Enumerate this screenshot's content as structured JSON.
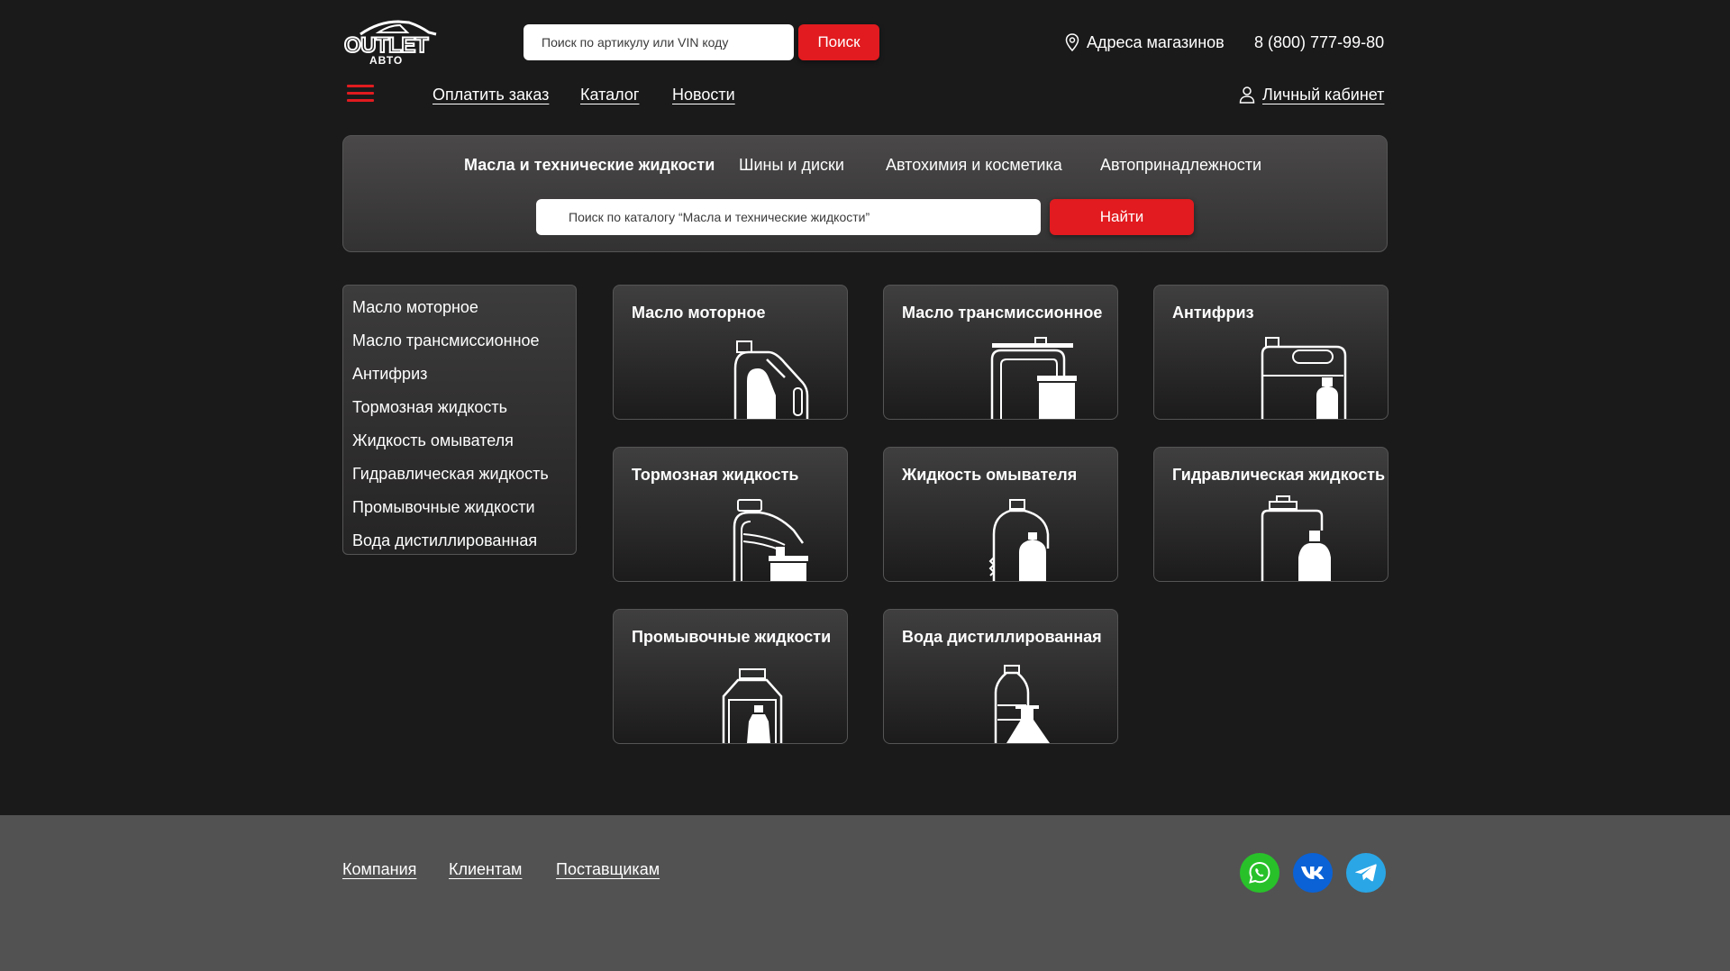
{
  "colors": {
    "accent": "#e11b1f",
    "background": "#1b1a1b",
    "footer": "#525252",
    "whatsapp": "#28c12a",
    "vk": "#0a62d6",
    "telegram": "#2aa6e6"
  },
  "header": {
    "logo_text": "OUTLET АВТО",
    "search_placeholder": "Поиск по артикулу или VIN коду",
    "search_button": "Поиск",
    "stores_label": "Адреса магазинов",
    "phone": "8 (800) 777-99-80",
    "nav": [
      "Оплатить заказ",
      "Каталог",
      "Новости"
    ],
    "cabinet_label": "Личный кабинет"
  },
  "category_panel": {
    "tabs": [
      "Масла и технические жидкости",
      "Шины и диски",
      "Автохимия и косметика",
      "Автопринадлежности"
    ],
    "active_tab": "Масла и технические жидкости",
    "search_placeholder": "Поиск по каталогу “Масла и технические жидкости”",
    "search_button": "Найти"
  },
  "sidebar": {
    "items": [
      "Масло моторное",
      "Масло трансмиссионное",
      "Антифриз",
      "Тормозная жидкость",
      "Жидкость омывателя",
      "Гидравлическая жидкость",
      "Промывочные жидкости",
      "Вода дистиллированная"
    ]
  },
  "cards": [
    {
      "title": "Масло моторное",
      "icon": "motor-oil-canister-icon"
    },
    {
      "title": "Масло трансмиссионное",
      "icon": "transmission-oil-canister-icon"
    },
    {
      "title": "Антифриз",
      "icon": "antifreeze-canister-icon"
    },
    {
      "title": "Тормозная жидкость",
      "icon": "brake-fluid-bottle-icon"
    },
    {
      "title": "Жидкость омывателя",
      "icon": "washer-fluid-bottle-icon"
    },
    {
      "title": "Гидравлическая жидкость",
      "icon": "hydraulic-fluid-canister-icon"
    },
    {
      "title": "Промывочные жидкости",
      "icon": "flushing-fluid-bottle-icon"
    },
    {
      "title": "Вода дистиллированная",
      "icon": "distilled-water-bottle-icon"
    }
  ],
  "footer": {
    "links": [
      "Компания",
      "Клиентам",
      "Поставщикам"
    ],
    "social": [
      "whatsapp-icon",
      "vk-icon",
      "telegram-icon"
    ]
  }
}
